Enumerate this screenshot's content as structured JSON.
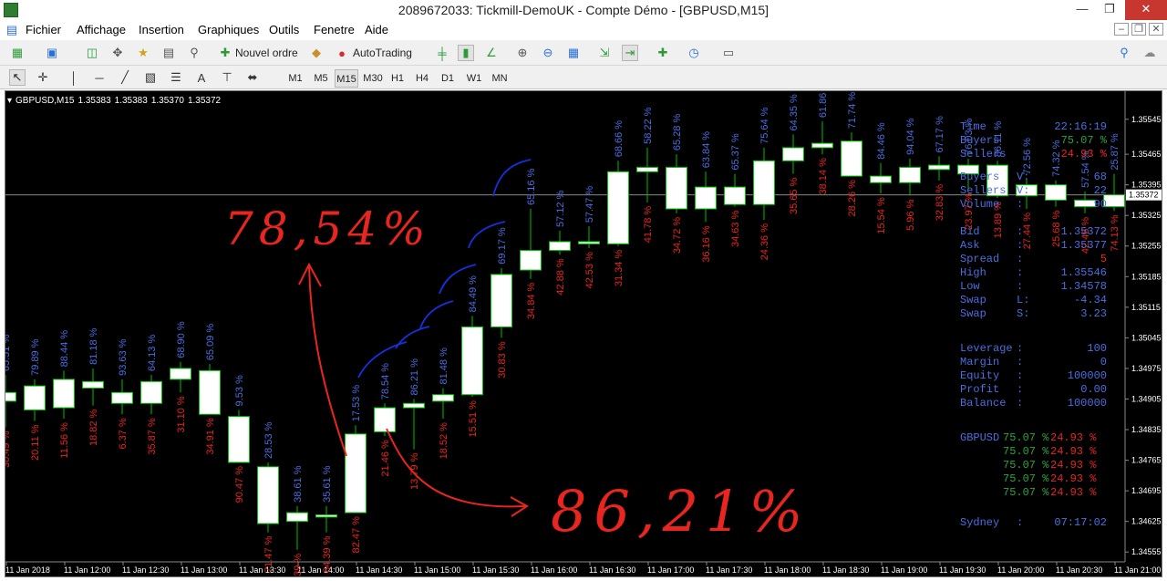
{
  "window": {
    "title": "2089672033: Tickmill-DemoUK - Compte Démo - [GBPUSD,M15]",
    "min_label": "—",
    "max_label": "❐",
    "close_label": "✕"
  },
  "menu": [
    "Fichier",
    "Affichage",
    "Insertion",
    "Graphiques",
    "Outils",
    "Fenetre",
    "Aide"
  ],
  "toolbar": {
    "new_order": "Nouvel ordre",
    "autotrading": "AutoTrading",
    "timeframes": [
      "M1",
      "M5",
      "M15",
      "M30",
      "H1",
      "H4",
      "D1",
      "W1",
      "MN"
    ],
    "selected_timeframe": "M15",
    "text_tool": "A"
  },
  "chart": {
    "symbol": "GBPUSD,M15",
    "ohlc": [
      "1.35383",
      "1.35383",
      "1.35370",
      "1.35372"
    ],
    "price_ticks": [
      "1.35545",
      "1.35465",
      "1.35395",
      "1.35325",
      "1.35255",
      "1.35185",
      "1.35115",
      "1.35045",
      "1.34975",
      "1.34905",
      "1.34835",
      "1.34765",
      "1.34695",
      "1.34625",
      "1.34555"
    ],
    "current_price": "1.35372",
    "time_ticks": [
      "11 Jan 2018",
      "11 Jan 12:00",
      "11 Jan 12:30",
      "11 Jan 13:00",
      "11 Jan 13:30",
      "11 Jan 14:00",
      "11 Jan 14:30",
      "11 Jan 15:00",
      "11 Jan 15:30",
      "11 Jan 16:00",
      "11 Jan 16:30",
      "11 Jan 17:00",
      "11 Jan 17:30",
      "11 Jan 18:00",
      "11 Jan 18:30",
      "11 Jan 19:00",
      "11 Jan 19:30",
      "11 Jan 20:00",
      "11 Jan 20:30",
      "11 Jan 21:00"
    ],
    "candles": [
      {
        "o": 1.349,
        "h": 1.3496,
        "l": 1.3484,
        "c": 1.3492,
        "buy": "65.51 %",
        "sell": "30.49 %"
      },
      {
        "o": 1.3488,
        "h": 1.3495,
        "l": 1.34855,
        "c": 1.34935,
        "buy": "79.89 %",
        "sell": "20.11 %"
      },
      {
        "o": 1.34885,
        "h": 1.3497,
        "l": 1.3486,
        "c": 1.3495,
        "buy": "88.44 %",
        "sell": "11.56 %"
      },
      {
        "o": 1.3493,
        "h": 1.34975,
        "l": 1.3489,
        "c": 1.34945,
        "buy": "81.18 %",
        "sell": "18.82 %"
      },
      {
        "o": 1.34895,
        "h": 1.3495,
        "l": 1.3487,
        "c": 1.3492,
        "buy": "93.63 %",
        "sell": "6.37 %"
      },
      {
        "o": 1.34895,
        "h": 1.3496,
        "l": 1.3487,
        "c": 1.34945,
        "buy": "64.13 %",
        "sell": "35.87 %"
      },
      {
        "o": 1.3495,
        "h": 1.3499,
        "l": 1.3492,
        "c": 1.34975,
        "buy": "68.90 %",
        "sell": "31.10 %"
      },
      {
        "o": 1.3497,
        "h": 1.34985,
        "l": 1.3487,
        "c": 1.3487,
        "buy": "65.09 %",
        "sell": "34.91 %"
      },
      {
        "o": 1.34865,
        "h": 1.3488,
        "l": 1.3476,
        "c": 1.3476,
        "buy": "9.53 %",
        "sell": "90.47 %"
      },
      {
        "o": 1.3475,
        "h": 1.3476,
        "l": 1.346,
        "c": 1.3462,
        "buy": "28.53 %",
        "sell": "71.47 %"
      },
      {
        "o": 1.34625,
        "h": 1.3466,
        "l": 1.3456,
        "c": 1.34645,
        "buy": "38.61 %",
        "sell": "61.39 %"
      },
      {
        "o": 1.3464,
        "h": 1.3466,
        "l": 1.346,
        "c": 1.34635,
        "buy": "35.61 %",
        "sell": "64.39 %"
      },
      {
        "o": 1.34645,
        "h": 1.34845,
        "l": 1.34645,
        "c": 1.34825,
        "buy": "17.53 %",
        "sell": "82.47 %"
      },
      {
        "o": 1.3483,
        "h": 1.34895,
        "l": 1.3482,
        "c": 1.34885,
        "buy": "78.54 %",
        "sell": "21.46 %"
      },
      {
        "o": 1.34885,
        "h": 1.34905,
        "l": 1.3479,
        "c": 1.34895,
        "buy": "86.21 %",
        "sell": "13.79 %"
      },
      {
        "o": 1.349,
        "h": 1.3493,
        "l": 1.3486,
        "c": 1.34915,
        "buy": "81.48 %",
        "sell": "18.52 %"
      },
      {
        "o": 1.34915,
        "h": 1.35095,
        "l": 1.3491,
        "c": 1.3507,
        "buy": "84.49 %",
        "sell": "15.51 %"
      },
      {
        "o": 1.3507,
        "h": 1.35205,
        "l": 1.35045,
        "c": 1.3519,
        "buy": "69.17 %",
        "sell": "30.83 %"
      },
      {
        "o": 1.352,
        "h": 1.3534,
        "l": 1.3518,
        "c": 1.35245,
        "buy": "65.16 %",
        "sell": "34.84 %"
      },
      {
        "o": 1.35245,
        "h": 1.3529,
        "l": 1.35235,
        "c": 1.35265,
        "buy": "57.12 %",
        "sell": "42.88 %"
      },
      {
        "o": 1.3526,
        "h": 1.353,
        "l": 1.3525,
        "c": 1.35265,
        "buy": "57.47 %",
        "sell": "42.53 %"
      },
      {
        "o": 1.3526,
        "h": 1.3545,
        "l": 1.35255,
        "c": 1.35425,
        "buy": "68.66 %",
        "sell": "31.34 %"
      },
      {
        "o": 1.35425,
        "h": 1.3548,
        "l": 1.35355,
        "c": 1.35435,
        "buy": "58.22 %",
        "sell": "41.78 %"
      },
      {
        "o": 1.35435,
        "h": 1.35465,
        "l": 1.3533,
        "c": 1.3534,
        "buy": "65.28 %",
        "sell": "34.72 %"
      },
      {
        "o": 1.3534,
        "h": 1.35425,
        "l": 1.3531,
        "c": 1.3539,
        "buy": "63.84 %",
        "sell": "36.16 %"
      },
      {
        "o": 1.3539,
        "h": 1.3542,
        "l": 1.35345,
        "c": 1.3535,
        "buy": "65.37 %",
        "sell": "34.63 %"
      },
      {
        "o": 1.3535,
        "h": 1.3548,
        "l": 1.35315,
        "c": 1.3545,
        "buy": "75.64 %",
        "sell": "24.36 %"
      },
      {
        "o": 1.3545,
        "h": 1.3551,
        "l": 1.3542,
        "c": 1.3548,
        "buy": "64.35 %",
        "sell": "35.65 %"
      },
      {
        "o": 1.3548,
        "h": 1.3554,
        "l": 1.35465,
        "c": 1.3549,
        "buy": "61.86 %",
        "sell": "38.14 %"
      },
      {
        "o": 1.35495,
        "h": 1.35515,
        "l": 1.35415,
        "c": 1.35415,
        "buy": "71.74 %",
        "sell": "28.26 %"
      },
      {
        "o": 1.35415,
        "h": 1.35445,
        "l": 1.35375,
        "c": 1.354,
        "buy": "84.46 %",
        "sell": "15.54 %"
      },
      {
        "o": 1.354,
        "h": 1.35455,
        "l": 1.3537,
        "c": 1.35435,
        "buy": "94.04 %",
        "sell": "5.96 %"
      },
      {
        "o": 1.3543,
        "h": 1.3546,
        "l": 1.35405,
        "c": 1.3544,
        "buy": "67.17 %",
        "sell": "32.83 %"
      },
      {
        "o": 1.3542,
        "h": 1.35455,
        "l": 1.35385,
        "c": 1.3544,
        "buy": "76.03 %",
        "sell": "23.97 %"
      },
      {
        "o": 1.3544,
        "h": 1.3545,
        "l": 1.35365,
        "c": 1.3537,
        "buy": "86.11 %",
        "sell": "13.89 %"
      },
      {
        "o": 1.3537,
        "h": 1.3541,
        "l": 1.3534,
        "c": 1.35395,
        "buy": "72.56 %",
        "sell": "27.44 %"
      },
      {
        "o": 1.35395,
        "h": 1.35405,
        "l": 1.35345,
        "c": 1.3536,
        "buy": "74.32 %",
        "sell": "25.68 %"
      },
      {
        "o": 1.3536,
        "h": 1.3538,
        "l": 1.3533,
        "c": 1.35345,
        "buy": "57.54 %",
        "sell": "42.46 %"
      },
      {
        "o": 1.35345,
        "h": 1.3542,
        "l": 1.35335,
        "c": 1.35372,
        "buy": "25.87 %",
        "sell": "74.13 %"
      }
    ],
    "annotations": {
      "left": "78,54%",
      "right": "86,21%"
    }
  },
  "info": {
    "time": {
      "k": "Time",
      "v": "22:16:19"
    },
    "buyers_pct": {
      "k": "Buyers",
      "v": "75.07 %"
    },
    "sellers_pct": {
      "k": "Sellers",
      "v": "24.93 %"
    },
    "buyers_v": {
      "k": "Buyers",
      "c": "V:",
      "v": "68"
    },
    "sellers_v": {
      "k": "Sellers",
      "c": "V:",
      "v": "22"
    },
    "volume": {
      "k": "Volume",
      "c": ":",
      "v": "90"
    },
    "bid": {
      "k": "Bid",
      "c": ":",
      "v": "1.35372"
    },
    "ask": {
      "k": "Ask",
      "c": ":",
      "v": "1.35377"
    },
    "spread": {
      "k": "Spread",
      "c": ":",
      "v": "5"
    },
    "high": {
      "k": "High",
      "c": ":",
      "v": "1.35546"
    },
    "low": {
      "k": "Low",
      "c": ":",
      "v": "1.34578"
    },
    "swap_l": {
      "k": "Swap",
      "c": "L:",
      "v": "-4.34"
    },
    "swap_s": {
      "k": "Swap",
      "c": "S:",
      "v": "3.23"
    },
    "leverage": {
      "k": "Leverage",
      "c": ":",
      "v": "100"
    },
    "margin": {
      "k": "Margin",
      "c": ":",
      "v": "0"
    },
    "equity": {
      "k": "Equity",
      "c": ":",
      "v": "100000"
    },
    "profit": {
      "k": "Profit",
      "c": ":",
      "v": "0.00"
    },
    "balance": {
      "k": "Balance",
      "c": ":",
      "v": "100000"
    },
    "pairs": [
      {
        "p": "GBPUSD",
        "g": "75.07 %",
        "r": "24.93 %"
      },
      {
        "p": "",
        "g": "75.07 %",
        "r": "24.93 %"
      },
      {
        "p": "",
        "g": "75.07 %",
        "r": "24.93 %"
      },
      {
        "p": "",
        "g": "75.07 %",
        "r": "24.93 %"
      },
      {
        "p": "",
        "g": "75.07 %",
        "r": "24.93 %"
      }
    ],
    "sydney": {
      "k": "Sydney",
      "c": ":",
      "v": "07:17:02"
    }
  },
  "colors": {
    "chart_bg": "#000000",
    "buy_label": "#4a6fe0",
    "sell_label": "#e8261f",
    "candle_up": "#ffffff",
    "candle_edge": "#00c000",
    "annotation_red": "#e8261f",
    "annotation_blue": "#1630e0"
  }
}
